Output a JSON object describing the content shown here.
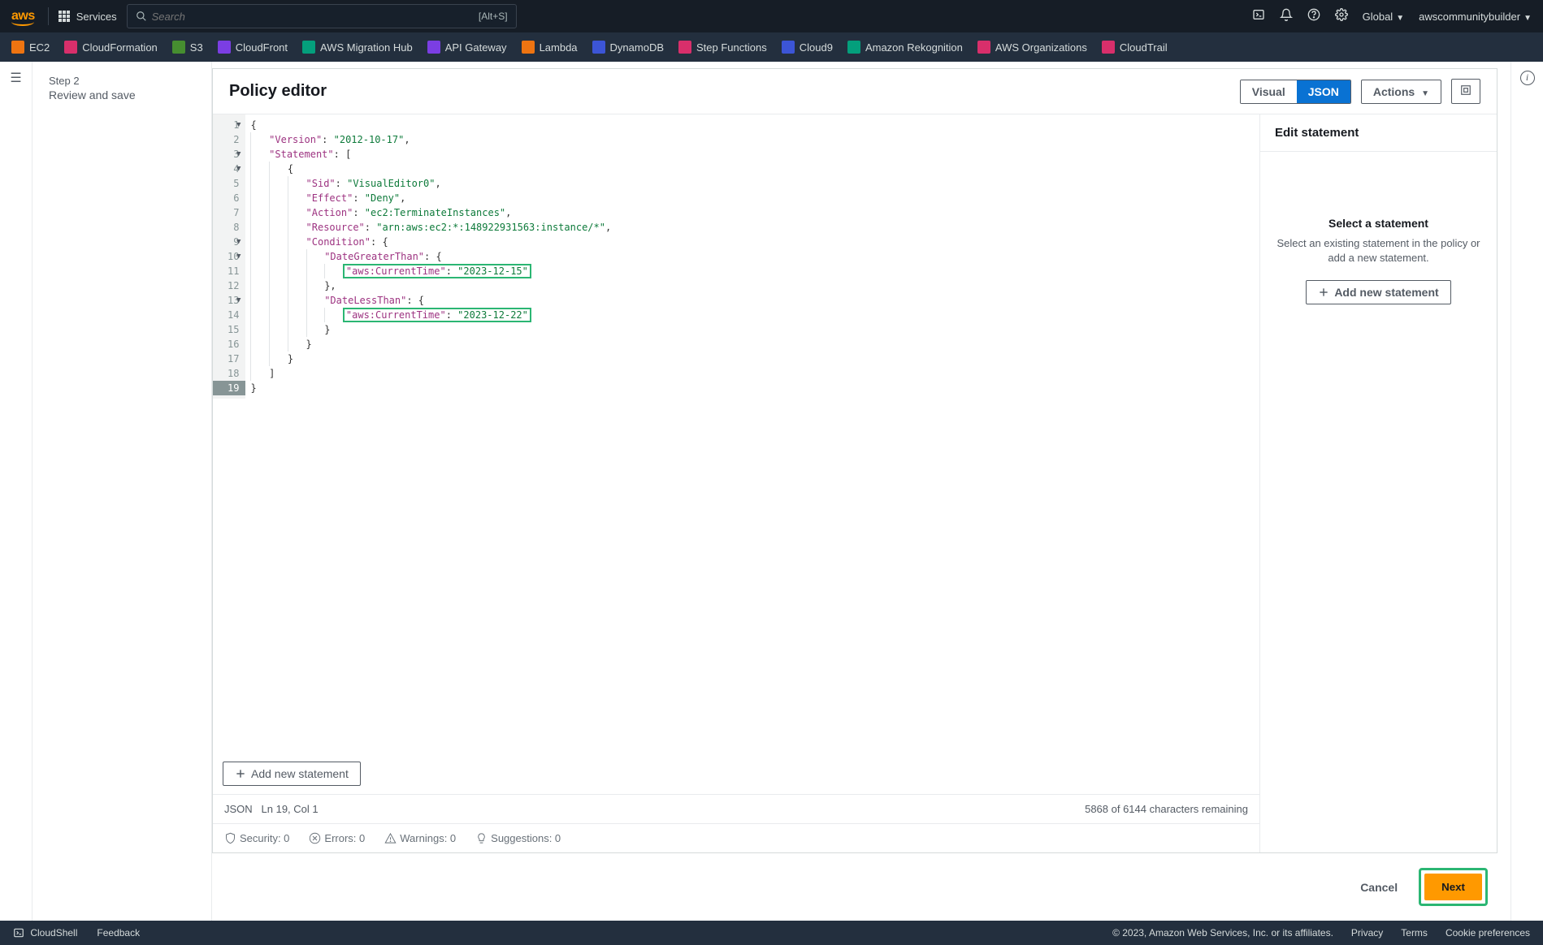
{
  "topbar": {
    "logo": "aws",
    "services_label": "Services",
    "search_placeholder": "Search",
    "search_shortcut": "[Alt+S]",
    "region_label": "Global",
    "account_label": "awscommunitybuilder"
  },
  "favorites": [
    {
      "label": "EC2",
      "c": "c-ec2"
    },
    {
      "label": "CloudFormation",
      "c": "c-cfn"
    },
    {
      "label": "S3",
      "c": "c-s3"
    },
    {
      "label": "CloudFront",
      "c": "c-cf"
    },
    {
      "label": "AWS Migration Hub",
      "c": "c-mh"
    },
    {
      "label": "API Gateway",
      "c": "c-api"
    },
    {
      "label": "Lambda",
      "c": "c-lam"
    },
    {
      "label": "DynamoDB",
      "c": "c-dyn"
    },
    {
      "label": "Step Functions",
      "c": "c-step"
    },
    {
      "label": "Cloud9",
      "c": "c-c9"
    },
    {
      "label": "Amazon Rekognition",
      "c": "c-rek"
    },
    {
      "label": "AWS Organizations",
      "c": "c-org"
    },
    {
      "label": "CloudTrail",
      "c": "c-ct"
    }
  ],
  "wizard": {
    "step_label": "Step 2",
    "step_title": "Review and save"
  },
  "editor": {
    "title": "Policy editor",
    "visual_label": "Visual",
    "json_label": "JSON",
    "actions_label": "Actions",
    "add_statement_label": "Add new statement",
    "status_mode": "JSON",
    "status_pos": "Ln 19, Col 1",
    "char_remaining": "5868 of 6144 characters remaining",
    "security_label": "Security: 0",
    "errors_label": "Errors: 0",
    "warnings_label": "Warnings: 0",
    "suggestions_label": "Suggestions: 0"
  },
  "policy": {
    "Version": "2012-10-17",
    "Statement": [
      {
        "Sid": "VisualEditor0",
        "Effect": "Deny",
        "Action": "ec2:TerminateInstances",
        "Resource": "arn:aws:ec2:*:148922931563:instance/*",
        "Condition": {
          "DateGreaterThan": {
            "aws:CurrentTime": "2023-12-15"
          },
          "DateLessThan": {
            "aws:CurrentTime": "2023-12-22"
          }
        }
      }
    ]
  },
  "code_lines": [
    {
      "n": 1,
      "fold": true,
      "indent": 0,
      "raw": [
        {
          "t": "pun",
          "v": "{"
        }
      ]
    },
    {
      "n": 2,
      "indent": 1,
      "raw": [
        {
          "t": "key",
          "v": "\"Version\""
        },
        {
          "t": "pun",
          "v": ": "
        },
        {
          "t": "str",
          "v": "\"2012-10-17\""
        },
        {
          "t": "pun",
          "v": ","
        }
      ]
    },
    {
      "n": 3,
      "fold": true,
      "indent": 1,
      "raw": [
        {
          "t": "key",
          "v": "\"Statement\""
        },
        {
          "t": "pun",
          "v": ": ["
        }
      ]
    },
    {
      "n": 4,
      "fold": true,
      "indent": 2,
      "raw": [
        {
          "t": "pun",
          "v": "{"
        }
      ]
    },
    {
      "n": 5,
      "indent": 3,
      "raw": [
        {
          "t": "key",
          "v": "\"Sid\""
        },
        {
          "t": "pun",
          "v": ": "
        },
        {
          "t": "str",
          "v": "\"VisualEditor0\""
        },
        {
          "t": "pun",
          "v": ","
        }
      ]
    },
    {
      "n": 6,
      "indent": 3,
      "raw": [
        {
          "t": "key",
          "v": "\"Effect\""
        },
        {
          "t": "pun",
          "v": ": "
        },
        {
          "t": "str",
          "v": "\"Deny\""
        },
        {
          "t": "pun",
          "v": ","
        }
      ]
    },
    {
      "n": 7,
      "indent": 3,
      "raw": [
        {
          "t": "key",
          "v": "\"Action\""
        },
        {
          "t": "pun",
          "v": ": "
        },
        {
          "t": "str",
          "v": "\"ec2:TerminateInstances\""
        },
        {
          "t": "pun",
          "v": ","
        }
      ]
    },
    {
      "n": 8,
      "indent": 3,
      "raw": [
        {
          "t": "key",
          "v": "\"Resource\""
        },
        {
          "t": "pun",
          "v": ": "
        },
        {
          "t": "str",
          "v": "\"arn:aws:ec2:*:148922931563:instance/*\""
        },
        {
          "t": "pun",
          "v": ","
        }
      ]
    },
    {
      "n": 9,
      "fold": true,
      "indent": 3,
      "raw": [
        {
          "t": "key",
          "v": "\"Condition\""
        },
        {
          "t": "pun",
          "v": ": {"
        }
      ]
    },
    {
      "n": 10,
      "fold": true,
      "indent": 4,
      "raw": [
        {
          "t": "key",
          "v": "\"DateGreaterThan\""
        },
        {
          "t": "pun",
          "v": ": {"
        }
      ]
    },
    {
      "n": 11,
      "indent": 5,
      "hl": true,
      "raw": [
        {
          "t": "key",
          "v": "\"aws:CurrentTime\""
        },
        {
          "t": "pun",
          "v": ": "
        },
        {
          "t": "str",
          "v": "\"2023-12-15\""
        }
      ]
    },
    {
      "n": 12,
      "indent": 4,
      "raw": [
        {
          "t": "pun",
          "v": "},"
        }
      ]
    },
    {
      "n": 13,
      "fold": true,
      "indent": 4,
      "raw": [
        {
          "t": "key",
          "v": "\"DateLessThan\""
        },
        {
          "t": "pun",
          "v": ": {"
        }
      ]
    },
    {
      "n": 14,
      "indent": 5,
      "hl": true,
      "raw": [
        {
          "t": "key",
          "v": "\"aws:CurrentTime\""
        },
        {
          "t": "pun",
          "v": ": "
        },
        {
          "t": "str",
          "v": "\"2023-12-22\""
        }
      ]
    },
    {
      "n": 15,
      "indent": 4,
      "raw": [
        {
          "t": "pun",
          "v": "}"
        }
      ]
    },
    {
      "n": 16,
      "indent": 3,
      "raw": [
        {
          "t": "pun",
          "v": "}"
        }
      ]
    },
    {
      "n": 17,
      "indent": 2,
      "raw": [
        {
          "t": "pun",
          "v": "}"
        }
      ]
    },
    {
      "n": 18,
      "indent": 1,
      "raw": [
        {
          "t": "pun",
          "v": "]"
        }
      ]
    },
    {
      "n": 19,
      "indent": 0,
      "curr": true,
      "raw": [
        {
          "t": "pun",
          "v": "}"
        }
      ]
    }
  ],
  "side_panel": {
    "heading": "Edit statement",
    "select_title": "Select a statement",
    "select_desc": "Select an existing statement in the policy or add a new statement.",
    "add_label": "Add new statement"
  },
  "footer_buttons": {
    "cancel": "Cancel",
    "next": "Next"
  },
  "bottom": {
    "cloudshell": "CloudShell",
    "feedback": "Feedback",
    "copyright": "© 2023, Amazon Web Services, Inc. or its affiliates.",
    "privacy": "Privacy",
    "terms": "Terms",
    "cookies": "Cookie preferences"
  }
}
